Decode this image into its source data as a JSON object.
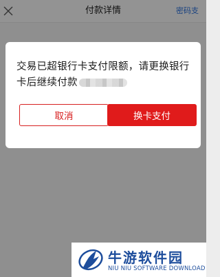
{
  "navbar": {
    "title": "付款详情",
    "right_link": "密码支"
  },
  "dialog": {
    "message": "交易已超银行卡支付限额，请更换银行卡后继续付款",
    "cancel_label": "取消",
    "confirm_label": "换卡支付"
  },
  "watermark": {
    "name": "牛游软件园",
    "subtitle": "NIU NIU SOFTWARE DOWNLOAD"
  },
  "colors": {
    "accent_red": "#e01b1b",
    "link_blue": "#2b6fd6",
    "watermark_blue": "#1d4d9c"
  }
}
